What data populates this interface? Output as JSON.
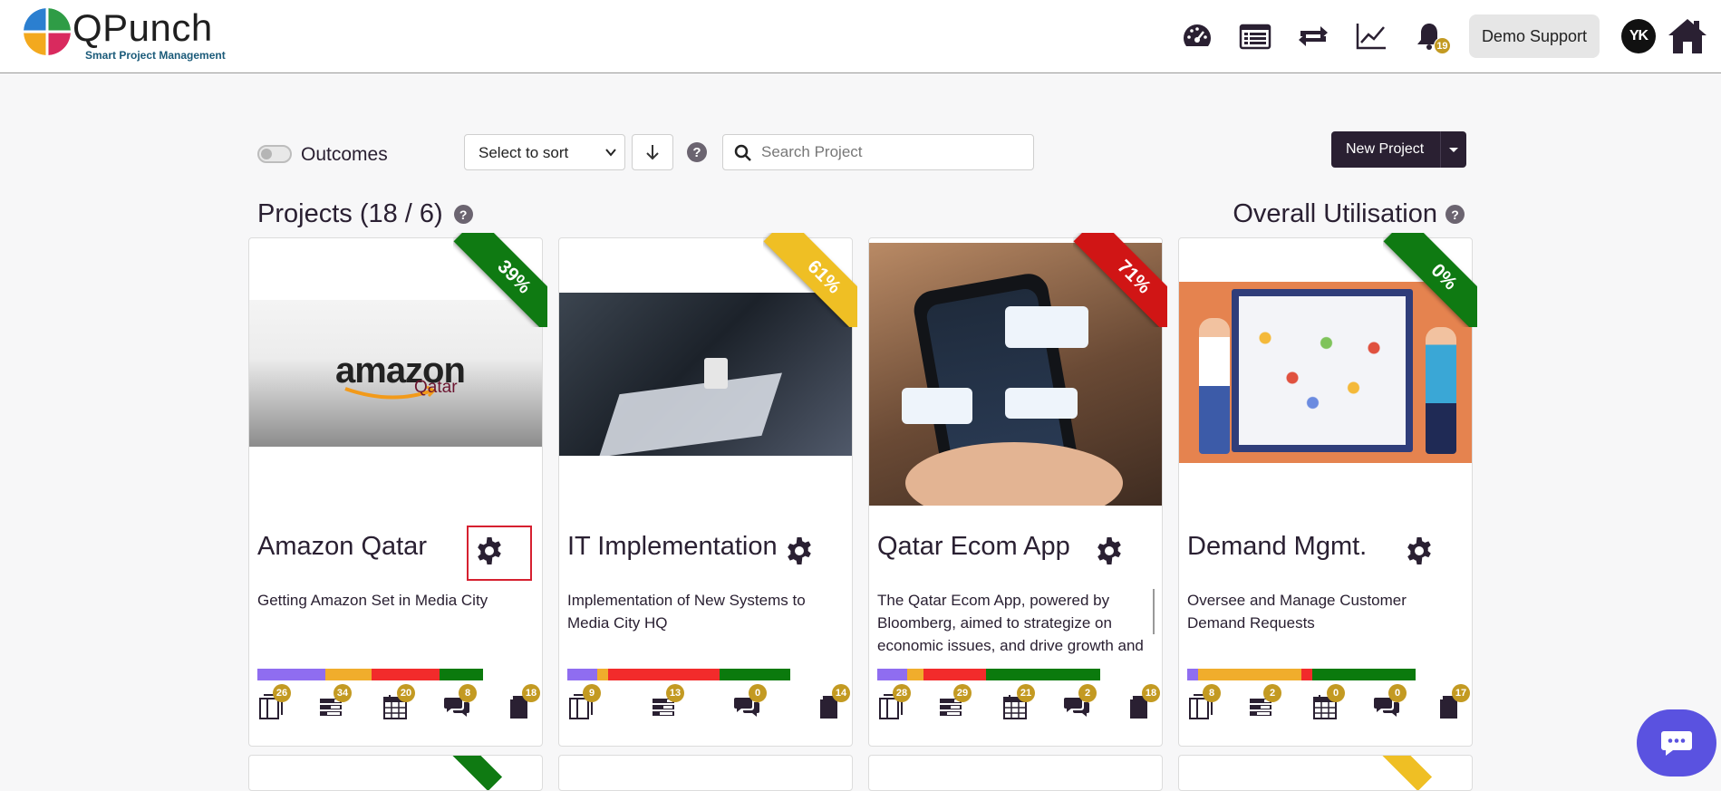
{
  "brand": {
    "name": "QPunch",
    "tagline": "Smart Project Management"
  },
  "header": {
    "icons": [
      "dashboard-icon",
      "list-icon",
      "sync-icon",
      "chart-icon",
      "bell-icon"
    ],
    "notification_count": "19",
    "user_button": "Demo Support",
    "avatar_initials": "YK"
  },
  "toolbar": {
    "toggle_label": "Outcomes",
    "sort_placeholder": "Select to sort",
    "search_placeholder": "Search Project",
    "new_project_label": "New Project"
  },
  "sections": {
    "projects_title": "Projects (18 / 6)",
    "utilisation_title": "Overall Utilisation"
  },
  "colors": {
    "primary": "#2a2032",
    "ribbon_green": "#0f7a12",
    "ribbon_yellow": "#efbf24",
    "ribbon_red": "#d01515",
    "badge": "#c39a22",
    "bar_purple": "#8f6df0",
    "bar_orange": "#f0ad2c",
    "bar_red": "#f22b2b",
    "bar_green": "#0b7a0d",
    "chat": "#5a52e0"
  },
  "projects": [
    {
      "title": "Amazon Qatar",
      "percent": "39%",
      "ribbon_color": "green",
      "description": "Getting Amazon Set in Media City",
      "image_text": "amazon",
      "image_subtext": "Qatar",
      "progress": [
        0.25,
        0.17,
        0.25,
        0.16
      ],
      "stats": [
        "26",
        "34",
        "20",
        "8",
        "18"
      ]
    },
    {
      "title": "IT Implementation",
      "percent": "61%",
      "ribbon_color": "yellow",
      "description": "Implementation of New Systems to Media City HQ",
      "progress": [
        0.11,
        0.04,
        0.41,
        0.26
      ],
      "stats": [
        "9",
        "13",
        "0",
        "14"
      ]
    },
    {
      "title": "Qatar Ecom App",
      "percent": "71%",
      "ribbon_color": "red",
      "description": "The Qatar Ecom App, powered by Bloomberg, aimed to strategize on economic issues, and drive growth and",
      "progress": [
        0.11,
        0.06,
        0.23,
        0.42
      ],
      "stats": [
        "28",
        "29",
        "21",
        "2",
        "18"
      ]
    },
    {
      "title": "Demand Mgmt.",
      "percent": "0%",
      "ribbon_color": "green",
      "description": "Oversee and Manage Customer Demand Requests",
      "progress": [
        0.04,
        0.38,
        0.04,
        0.38
      ],
      "stats": [
        "8",
        "2",
        "0",
        "0",
        "17"
      ]
    }
  ]
}
